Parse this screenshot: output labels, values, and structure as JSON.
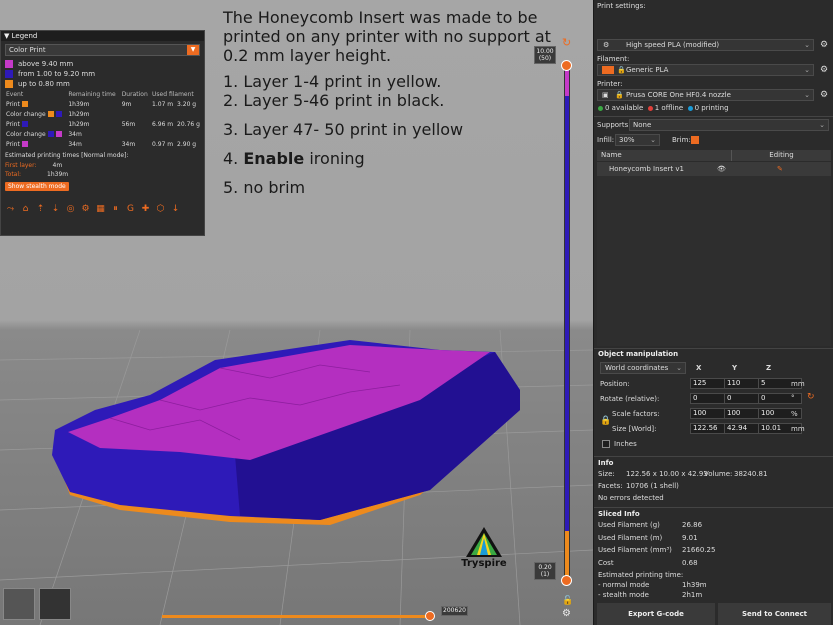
{
  "legend": {
    "title": "Legend",
    "view_type": "Color Print",
    "ranges": [
      {
        "label": "above 9.40 mm",
        "color": "#c53ac8"
      },
      {
        "label": "from 1.00 to 9.20 mm",
        "color": "#2e1ab8"
      },
      {
        "label": "up to 0.80 mm",
        "color": "#ed8a1d"
      }
    ],
    "columns": [
      "Event",
      "Remaining time",
      "Duration",
      "Used filament"
    ],
    "rows": [
      {
        "event": "Print",
        "colors": [
          "#ed8a1d"
        ],
        "remaining": "1h39m",
        "duration": "9m",
        "length": "1.07 m",
        "weight": "3.20 g"
      },
      {
        "event": "Color change",
        "colors": [
          "#ed8a1d",
          "#2e1ab8"
        ],
        "remaining": "1h29m",
        "duration": "",
        "length": "",
        "weight": ""
      },
      {
        "event": "Print",
        "colors": [
          "#2e1ab8"
        ],
        "remaining": "1h29m",
        "duration": "56m",
        "length": "6.96 m",
        "weight": "20.76 g"
      },
      {
        "event": "Color change",
        "colors": [
          "#2e1ab8",
          "#c53ac8"
        ],
        "remaining": "34m",
        "duration": "",
        "length": "",
        "weight": ""
      },
      {
        "event": "Print",
        "colors": [
          "#c53ac8"
        ],
        "remaining": "34m",
        "duration": "34m",
        "length": "0.97 m",
        "weight": "2.90 g"
      }
    ],
    "estimated_title": "Estimated printing times [Normal mode]:",
    "first_layer_label": "First layer:",
    "first_layer_value": "4m",
    "total_label": "Total:",
    "total_value": "1h39m",
    "stealth_button": "Show stealth mode",
    "toolbar_icons": [
      "travel-icon",
      "wipe-icon",
      "retractions-icon",
      "deretractions-icon",
      "seams-icon",
      "tool-changes-icon",
      "color-changes-icon",
      "pause-prints-icon",
      "custom-gcodes-icon",
      "center-of-gravity-icon",
      "shells-icon",
      "tool-marker-icon"
    ]
  },
  "note": {
    "intro": "The Honeycomb Insert was made to be printed on any printer with no support at 0.2 mm layer height.",
    "step1": "1. Layer 1-4 print in yellow.",
    "step2": "2. Layer 5-46 print in black.",
    "step3": "3. Layer 47- 50 print in yellow",
    "step4_prefix": "4. ",
    "step4_bold": "Enable",
    "step4_suffix": " ironing",
    "step5": "5. no brim"
  },
  "vslider": {
    "top_value": "10.00",
    "top_layer": "(50)",
    "bottom_value": "0.20",
    "bottom_layer": "(1)"
  },
  "hslider": {
    "value": "200620"
  },
  "logo": {
    "text": "Tryspire"
  },
  "panel": {
    "print_settings_label": "Print settings:",
    "print_settings_value": "High speed PLA (modified)",
    "filament_label": "Filament:",
    "filament_value": "Generic PLA",
    "filament_color": "#ed6b21",
    "printer_label": "Printer:",
    "printer_value": "Prusa CORE One HF0.4 nozzle",
    "status_available": "0 available",
    "status_offline": "1 offline",
    "status_printing": "0 printing",
    "supports_label": "Supports:",
    "supports_value": "None",
    "infill_label": "Infill:",
    "infill_value": "30%",
    "brim_label": "Brim:",
    "brim_checked": true,
    "col_name": "Name",
    "col_editing": "Editing",
    "object_name": "Honeycomb Insert v1"
  },
  "object_manipulation": {
    "title": "Object manipulation",
    "coords": "World coordinates",
    "axis_x": "X",
    "axis_y": "Y",
    "axis_z": "Z",
    "position_label": "Position:",
    "position": [
      "125",
      "110",
      "5"
    ],
    "position_unit": "mm",
    "rotate_label": "Rotate (relative):",
    "rotate": [
      "0",
      "0",
      "0"
    ],
    "rotate_unit": "°",
    "scale_label": "Scale factors:",
    "scale": [
      "100",
      "100",
      "100"
    ],
    "scale_unit": "%",
    "size_label": "Size [World]:",
    "size": [
      "122.56",
      "42.94",
      "10.01"
    ],
    "size_unit": "mm",
    "inches_label": "Inches"
  },
  "info": {
    "title": "Info",
    "size_label": "Size:",
    "size_value": "122.56 x 10.00 x 42.93",
    "volume_label": "Volume:",
    "volume_value": "38240.81",
    "facets_label": "Facets:",
    "facets_value": "10706 (1 shell)",
    "errors": "No errors detected"
  },
  "sliced_info": {
    "title": "Sliced Info",
    "rows": [
      {
        "label": "Used Filament (g)",
        "value": "26.86"
      },
      {
        "label": "Used Filament (m)",
        "value": "9.01"
      },
      {
        "label": "Used Filament (mm³)",
        "value": "21660.25"
      },
      {
        "label": "Cost",
        "value": "0.68"
      }
    ],
    "time_label": "Estimated printing time:",
    "normal_label": "- normal mode",
    "normal_value": "1h39m",
    "stealth_label": "- stealth mode",
    "stealth_value": "2h1m"
  },
  "buttons": {
    "export": "Export G-code",
    "send": "Send to Connect"
  }
}
